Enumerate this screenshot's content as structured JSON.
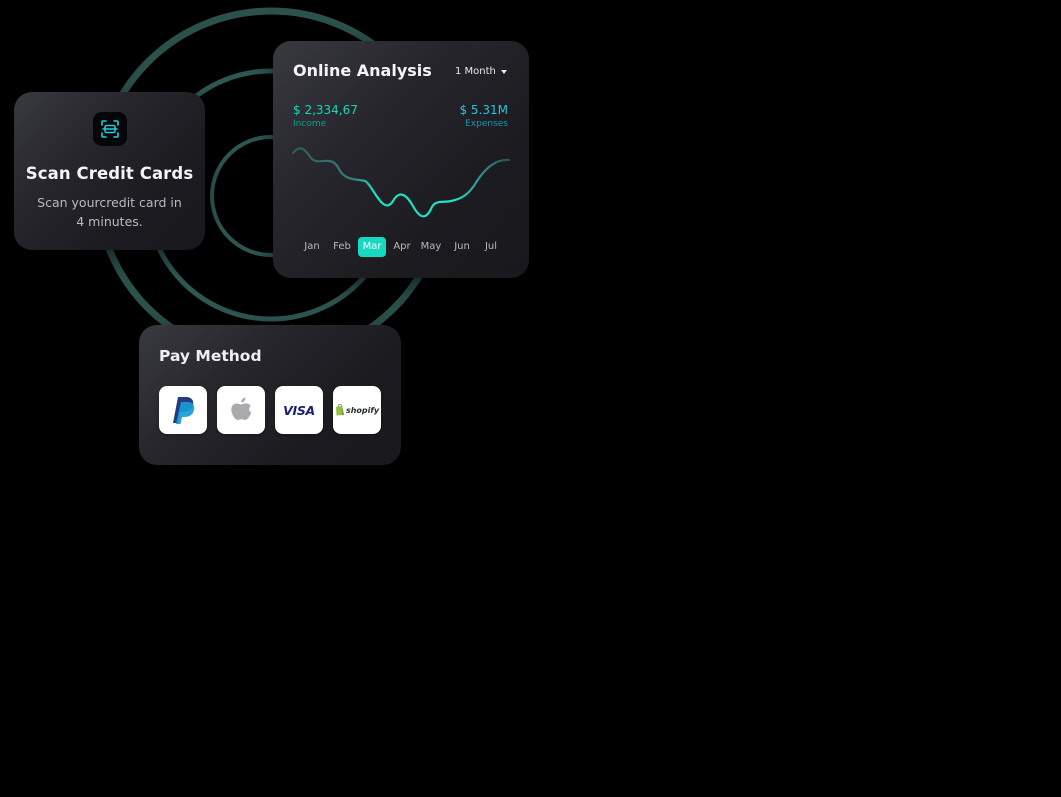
{
  "colors": {
    "background": "#000000",
    "ring": "#2f5752",
    "accent": "#17d9c2",
    "income": "#16d9b7",
    "expenses": "#2bc3e0"
  },
  "scan_card": {
    "icon": "scan-card-icon",
    "title": "Scan Credit Cards",
    "description": "Scan yourcredit card in 4 minutes."
  },
  "analysis": {
    "title": "Online Analysis",
    "period": "1 Month",
    "income_value": "$ 2,334,67",
    "income_label": "Income",
    "expenses_value": "$ 5.31M",
    "expenses_label": "Expenses",
    "months": [
      "Jan",
      "Feb",
      "Mar",
      "Apr",
      "May",
      "Jun",
      "Jul"
    ],
    "selected_month": "Mar"
  },
  "pay_method": {
    "title": "Pay Method",
    "options": [
      {
        "name": "PayPal",
        "icon": "paypal-icon"
      },
      {
        "name": "Apple Pay",
        "icon": "apple-icon"
      },
      {
        "name": "VISA",
        "icon": "visa-icon"
      },
      {
        "name": "shopify",
        "icon": "shopify-icon"
      }
    ]
  }
}
